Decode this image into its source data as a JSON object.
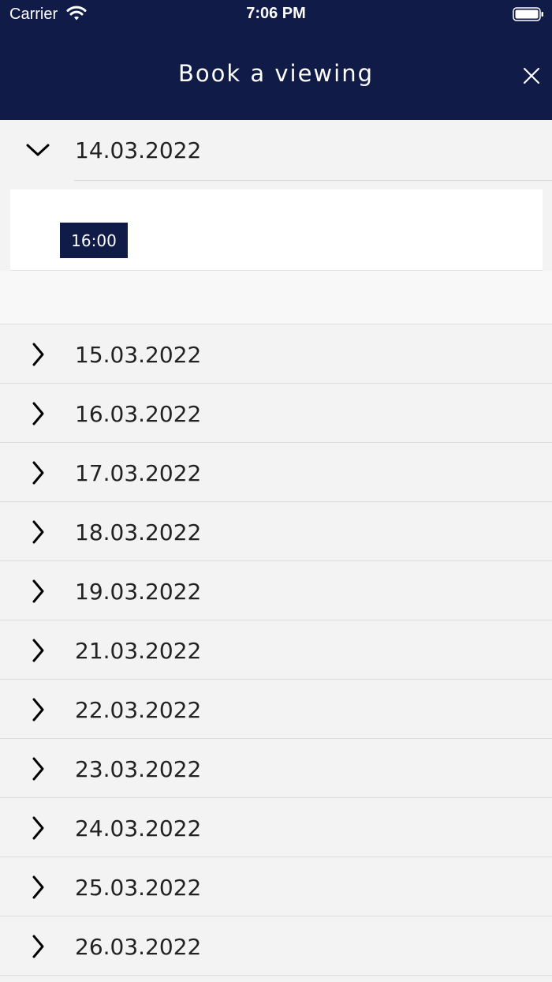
{
  "status_bar": {
    "carrier": "Carrier",
    "time": "7:06 PM"
  },
  "header": {
    "title": "Book a viewing"
  },
  "expanded_date": {
    "label": "14.03.2022",
    "slots": [
      "16:00"
    ]
  },
  "dates": [
    "15.03.2022",
    "16.03.2022",
    "17.03.2022",
    "18.03.2022",
    "19.03.2022",
    "21.03.2022",
    "22.03.2022",
    "23.03.2022",
    "24.03.2022",
    "25.03.2022",
    "26.03.2022"
  ],
  "colors": {
    "header_bg": "#111b47",
    "row_bg": "#f3f3f3",
    "slot_bg": "#111b47"
  },
  "icons": {
    "collapsed": "chevron-right-icon",
    "expanded": "chevron-down-icon",
    "close": "close-icon"
  }
}
